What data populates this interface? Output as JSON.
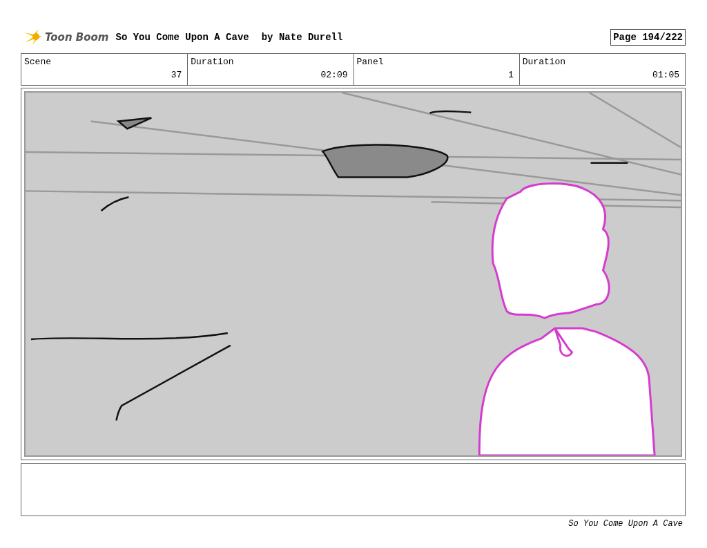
{
  "header": {
    "logo": "Toon Boom",
    "title": "So You Come Upon A Cave",
    "author": "by Nate Durell",
    "page": "Page 194/222"
  },
  "info": [
    {
      "label": "Scene",
      "value": "37"
    },
    {
      "label": "Duration",
      "value": "02:09"
    },
    {
      "label": "Panel",
      "value": "1"
    },
    {
      "label": "Duration",
      "value": "01:05"
    }
  ],
  "footer": "So You Come Upon A Cave"
}
